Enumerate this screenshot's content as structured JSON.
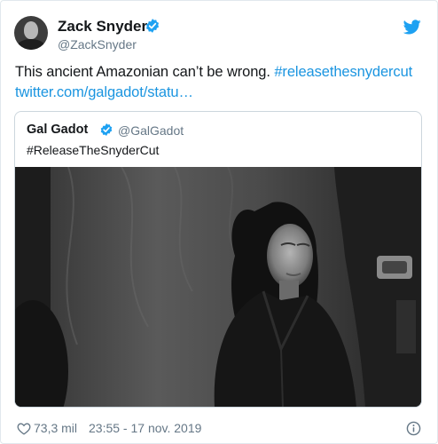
{
  "tweet": {
    "author_name": "Zack Snyder",
    "author_handle": "@ZackSnyder",
    "text": "This ancient Amazonian can’t be wrong.",
    "hashtag": "#releasethesnydercut",
    "link": "twitter.com/galgadot/statu…",
    "likes": "73,3 mil",
    "timestamp": "23:55 - 17 nov. 2019"
  },
  "quoted": {
    "author_name": "Gal Gadot",
    "author_handle": "@GalGadot",
    "text": "#ReleaseTheSnyderCut"
  },
  "icons": {
    "verified": "verified-badge-icon",
    "brand": "twitter-bird-icon",
    "like": "heart-icon",
    "info": "info-icon"
  },
  "colors": {
    "link": "#1b95e0",
    "verified": "#1da1f2",
    "muted": "#657786",
    "text": "#14171a",
    "border": "#e1e8ed"
  }
}
